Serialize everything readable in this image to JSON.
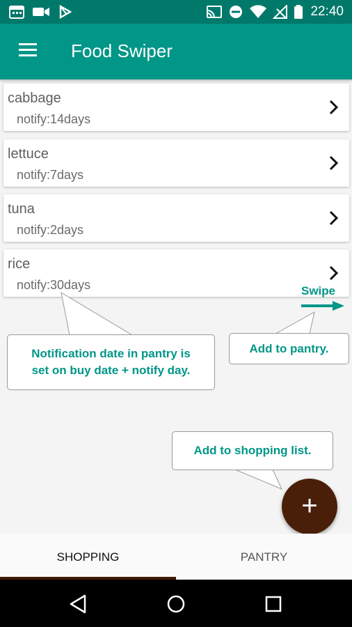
{
  "status_bar": {
    "time": "22:40",
    "left_icons": [
      "calendar-icon",
      "video-icon",
      "play-store-icon"
    ],
    "right_icons": [
      "cast-icon",
      "do-not-disturb-icon",
      "wifi-icon",
      "no-signal-icon",
      "battery-icon"
    ]
  },
  "app_bar": {
    "title": "Food Swiper",
    "menu_icon": "menu-icon"
  },
  "items": [
    {
      "name": "cabbage",
      "notify": "notify:14days"
    },
    {
      "name": "lettuce",
      "notify": "notify:7days"
    },
    {
      "name": "tuna",
      "notify": "notify:2days"
    },
    {
      "name": "rice",
      "notify": "notify:30days"
    }
  ],
  "callouts": {
    "notification_line1": "Notification date in pantry is",
    "notification_line2": "set on buy date + notify day.",
    "pantry": "Add to pantry.",
    "shopping": "Add to shopping list.",
    "swipe": "Swipe"
  },
  "fab": {
    "label": "+"
  },
  "tabs": [
    {
      "label": "SHOPPING",
      "selected": true
    },
    {
      "label": "PANTRY",
      "selected": false
    }
  ],
  "colors": {
    "primary_dark": "#00796b",
    "primary": "#009688",
    "accent": "#4a1f0a",
    "annotation_text": "#009688"
  }
}
